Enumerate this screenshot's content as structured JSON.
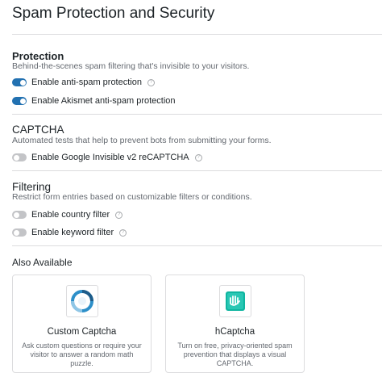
{
  "page": {
    "title": "Spam Protection and Security"
  },
  "protection": {
    "title": "Protection",
    "description": "Behind-the-scenes spam filtering that's invisible to your visitors.",
    "toggles": [
      {
        "label": "Enable anti-spam protection",
        "on": true,
        "help": true
      },
      {
        "label": "Enable Akismet anti-spam protection",
        "on": true,
        "help": false
      }
    ]
  },
  "captcha": {
    "title": "CAPTCHA",
    "description": "Automated tests that help to prevent bots from submitting your forms.",
    "toggles": [
      {
        "label": "Enable Google Invisible v2 reCAPTCHA",
        "on": false,
        "help": true
      }
    ]
  },
  "filtering": {
    "title": "Filtering",
    "description": "Restrict form entries based on customizable filters or conditions.",
    "toggles": [
      {
        "label": "Enable country filter",
        "on": false,
        "help": true
      },
      {
        "label": "Enable keyword filter",
        "on": false,
        "help": true
      }
    ]
  },
  "also_available": {
    "title": "Also Available",
    "cards": [
      {
        "name": "Custom Captcha",
        "description": "Ask custom questions or require your visitor to answer a random math puzzle.",
        "icon": "custom-captcha-logo-icon"
      },
      {
        "name": "hCaptcha",
        "description": "Turn on free, privacy-oriented spam prevention that displays a visual CAPTCHA.",
        "icon": "hcaptcha-logo-icon"
      }
    ]
  },
  "colors": {
    "accent": "#2271b1",
    "toggle_off": "#c3c4c7",
    "hcaptcha": "#0fb5a0"
  }
}
